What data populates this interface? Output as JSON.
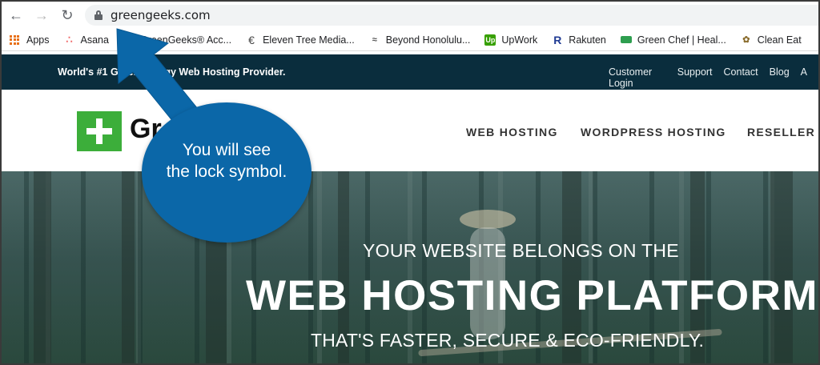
{
  "browser": {
    "url": "greengeeks.com"
  },
  "bookmarks": [
    {
      "label": "Apps",
      "icon": "apps-grid-icon"
    },
    {
      "label": "Asana",
      "icon": "asana-icon"
    },
    {
      "label": "GreenGeeks® Acc...",
      "icon": "doc-icon"
    },
    {
      "label": "Eleven Tree Media...",
      "icon": "eleven-tree-icon"
    },
    {
      "label": "Beyond Honolulu...",
      "icon": "beyond-icon"
    },
    {
      "label": "UpWork",
      "icon": "upwork-icon"
    },
    {
      "label": "Rakuten",
      "icon": "rakuten-icon"
    },
    {
      "label": "Green Chef | Heal...",
      "icon": "greenchef-icon"
    },
    {
      "label": "Clean Eat",
      "icon": "clean-eat-icon"
    }
  ],
  "site": {
    "tagline": "World's #1 Green Energy Web Hosting Provider.",
    "top_links": [
      "Customer Login",
      "Support",
      "Contact",
      "Blog",
      "A"
    ],
    "logo_text": "Gr",
    "menu": [
      "WEB HOSTING",
      "WORDPRESS HOSTING",
      "RESELLER"
    ],
    "hero": {
      "line1": "YOUR WEBSITE BELONGS ON THE",
      "line2": "WEB HOSTING PLATFORM",
      "line3": "THAT'S FASTER, SECURE & ECO-FRIENDLY."
    }
  },
  "annotation": {
    "text_line1": "You will see",
    "text_line2": "the lock symbol.",
    "color": "#0b67a8"
  },
  "colors": {
    "header_dark": "#0a2d3d",
    "logo_green": "#3cae3a"
  }
}
